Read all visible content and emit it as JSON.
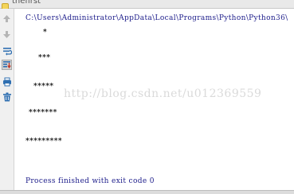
{
  "tab": {
    "label": "thefirst",
    "icon": "python-file-icon"
  },
  "toolbar": [
    {
      "name": "up-arrow-icon"
    },
    {
      "name": "down-arrow-icon"
    },
    {
      "name": "soft-wrap-icon"
    },
    {
      "name": "scroll-to-end-icon"
    },
    {
      "name": "print-icon"
    },
    {
      "name": "trash-icon"
    }
  ],
  "console": {
    "command_path": "C:\\Users\\Administrator\\AppData\\Local\\Programs\\Python\\Python36\\",
    "output": [
      "*",
      "***",
      "*****",
      "*******",
      "*********"
    ],
    "exit_message": "Process finished with exit code 0"
  },
  "watermark": "http://blog.csdn.net/u012369559",
  "colors": {
    "console_text": "#1c1c8a",
    "toolbar_accent": "#2f6fb1"
  }
}
